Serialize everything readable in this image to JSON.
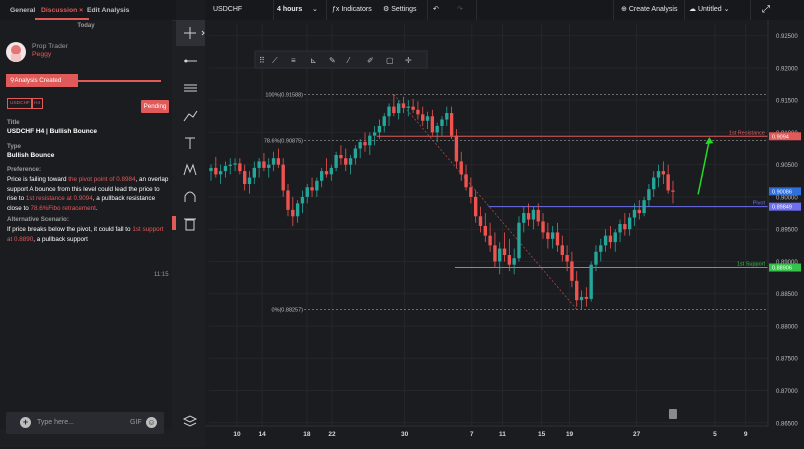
{
  "panel": {
    "tabs": [
      {
        "label": "General"
      },
      {
        "label": "Discussion ×"
      },
      {
        "label": "Edit Analysis"
      }
    ],
    "today": "Today",
    "author_role": "Prop Trader",
    "author_name": "Peggy",
    "status_banner": "Analysis Created",
    "tag1": "USDCHF",
    "tag2": "H4",
    "pending": "Pending",
    "title_label": "Title",
    "title_value": "USDCHF H4 | Bullish Bounce",
    "type_label": "Type",
    "type_value": "Bullish Bounce",
    "pref_label": "Preference:",
    "pref_parts": [
      "Price is failing toward ",
      "the pivot point of 0.8984",
      ", an overlap support  A bounce from this level could lead the price to rise to ",
      "1st resistance at 0.9094",
      ", a pullback resistance close to ",
      "78.6%Fibo retracement",
      "."
    ],
    "alt_label": "Alternative Scenario:",
    "alt_parts": [
      "If price breaks below the pivot, it could fall to ",
      "1st support at 0.8890",
      ", a pullback support"
    ],
    "time": "11:15",
    "input_placeholder": "Type here...",
    "gif_label": "GIF"
  },
  "toolbar": {
    "symbol": "USDCHF",
    "interval": "4 hours",
    "indicators": "Indicators",
    "settings": "Settings",
    "create_analysis": "Create Analysis",
    "layout_name": "Untitled"
  },
  "chart_data": {
    "type": "candlestick",
    "symbol": "USDCHF",
    "interval": "4 hours",
    "y_ticks": [
      "0.92500",
      "0.92000",
      "0.91500",
      "0.91000",
      "0.90500",
      "0.90000",
      "0.89500",
      "0.89000",
      "0.88500",
      "0.88000",
      "0.87500",
      "0.87000",
      "0.86500"
    ],
    "x_ticks": [
      "10",
      "14",
      "18",
      "22",
      "30",
      "7",
      "11",
      "15",
      "19",
      "27",
      "5",
      "9",
      "13"
    ],
    "x_tick_pos": [
      0.05,
      0.095,
      0.175,
      0.22,
      0.35,
      0.47,
      0.525,
      0.595,
      0.645,
      0.765,
      0.905,
      0.96,
      1.02
    ],
    "ylim": [
      0.8645,
      0.9268
    ],
    "lines": [
      {
        "name": "1st Resistance",
        "value": 0.9094,
        "label_value": "0.9094",
        "color": "#e05a5a"
      },
      {
        "name": "Pivot",
        "value": 0.89849,
        "label_value": "0.89849",
        "color": "#6e6ef0"
      },
      {
        "name": "1st Support",
        "value": 0.88906,
        "label_value": "0.88906",
        "color": "#36c24a"
      }
    ],
    "current_price": {
      "value": 0.90086,
      "label": "0.90086",
      "color": "#2f6fdc"
    },
    "fib_levels": [
      {
        "label": "100%(0.91588)",
        "value": 0.91588
      },
      {
        "label": "78.6%(0.90875)",
        "value": 0.90875
      },
      {
        "label": "0%(0.88257)",
        "value": 0.88257
      }
    ],
    "candles": [
      [
        0.904,
        0.905,
        0.9025,
        0.9045
      ],
      [
        0.9045,
        0.9062,
        0.903,
        0.9035
      ],
      [
        0.9035,
        0.905,
        0.902,
        0.904
      ],
      [
        0.904,
        0.9055,
        0.903,
        0.9048
      ],
      [
        0.9048,
        0.906,
        0.9035,
        0.905
      ],
      [
        0.905,
        0.906,
        0.904,
        0.9052
      ],
      [
        0.9052,
        0.906,
        0.9035,
        0.904
      ],
      [
        0.904,
        0.905,
        0.901,
        0.902
      ],
      [
        0.902,
        0.904,
        0.9005,
        0.903
      ],
      [
        0.903,
        0.9055,
        0.902,
        0.9045
      ],
      [
        0.9045,
        0.906,
        0.903,
        0.9055
      ],
      [
        0.9055,
        0.9068,
        0.904,
        0.9045
      ],
      [
        0.9045,
        0.906,
        0.903,
        0.905
      ],
      [
        0.905,
        0.907,
        0.904,
        0.906
      ],
      [
        0.906,
        0.9075,
        0.9045,
        0.905
      ],
      [
        0.905,
        0.906,
        0.9,
        0.901
      ],
      [
        0.901,
        0.902,
        0.897,
        0.898
      ],
      [
        0.898,
        0.9,
        0.8955,
        0.897
      ],
      [
        0.897,
        0.8995,
        0.896,
        0.899
      ],
      [
        0.899,
        0.901,
        0.8975,
        0.9
      ],
      [
        0.9,
        0.902,
        0.899,
        0.9015
      ],
      [
        0.9015,
        0.903,
        0.9,
        0.901
      ],
      [
        0.901,
        0.903,
        0.9,
        0.9025
      ],
      [
        0.9025,
        0.9045,
        0.9015,
        0.904
      ],
      [
        0.904,
        0.906,
        0.903,
        0.9035
      ],
      [
        0.9035,
        0.905,
        0.9025,
        0.9045
      ],
      [
        0.9045,
        0.907,
        0.904,
        0.9065
      ],
      [
        0.9065,
        0.908,
        0.905,
        0.906
      ],
      [
        0.906,
        0.9075,
        0.904,
        0.905
      ],
      [
        0.905,
        0.9065,
        0.9035,
        0.906
      ],
      [
        0.906,
        0.908,
        0.905,
        0.9075
      ],
      [
        0.9075,
        0.909,
        0.906,
        0.9085
      ],
      [
        0.9085,
        0.91,
        0.907,
        0.908
      ],
      [
        0.908,
        0.91,
        0.9065,
        0.9095
      ],
      [
        0.9095,
        0.911,
        0.908,
        0.91
      ],
      [
        0.91,
        0.912,
        0.909,
        0.911
      ],
      [
        0.911,
        0.913,
        0.91,
        0.9125
      ],
      [
        0.9125,
        0.9145,
        0.911,
        0.914
      ],
      [
        0.914,
        0.9159,
        0.9125,
        0.913
      ],
      [
        0.913,
        0.915,
        0.912,
        0.9145
      ],
      [
        0.9145,
        0.9155,
        0.913,
        0.9138
      ],
      [
        0.9138,
        0.915,
        0.9125,
        0.914
      ],
      [
        0.914,
        0.9152,
        0.913,
        0.9135
      ],
      [
        0.9135,
        0.9148,
        0.912,
        0.9128
      ],
      [
        0.9128,
        0.914,
        0.911,
        0.9118
      ],
      [
        0.9118,
        0.9132,
        0.9105,
        0.9125
      ],
      [
        0.9125,
        0.9135,
        0.9095,
        0.91
      ],
      [
        0.91,
        0.9115,
        0.9085,
        0.911
      ],
      [
        0.911,
        0.9125,
        0.9095,
        0.912
      ],
      [
        0.912,
        0.914,
        0.911,
        0.913
      ],
      [
        0.913,
        0.914,
        0.909,
        0.9095
      ],
      [
        0.9095,
        0.9105,
        0.9045,
        0.9055
      ],
      [
        0.9055,
        0.907,
        0.9025,
        0.9035
      ],
      [
        0.9035,
        0.905,
        0.901,
        0.9015
      ],
      [
        0.9015,
        0.903,
        0.899,
        0.9
      ],
      [
        0.9,
        0.901,
        0.896,
        0.897
      ],
      [
        0.897,
        0.8985,
        0.8945,
        0.8955
      ],
      [
        0.8955,
        0.8975,
        0.893,
        0.894
      ],
      [
        0.894,
        0.896,
        0.8915,
        0.8925
      ],
      [
        0.8925,
        0.8945,
        0.889,
        0.89
      ],
      [
        0.89,
        0.893,
        0.888,
        0.892
      ],
      [
        0.892,
        0.8945,
        0.89,
        0.891
      ],
      [
        0.891,
        0.8935,
        0.8885,
        0.8895
      ],
      [
        0.8895,
        0.892,
        0.888,
        0.8905
      ],
      [
        0.8905,
        0.897,
        0.89,
        0.896
      ],
      [
        0.896,
        0.8985,
        0.8945,
        0.8975
      ],
      [
        0.8975,
        0.899,
        0.8955,
        0.8965
      ],
      [
        0.8965,
        0.8985,
        0.895,
        0.898
      ],
      [
        0.898,
        0.899,
        0.8955,
        0.8962
      ],
      [
        0.8962,
        0.8975,
        0.8935,
        0.8945
      ],
      [
        0.8945,
        0.896,
        0.892,
        0.8935
      ],
      [
        0.8935,
        0.8955,
        0.892,
        0.8945
      ],
      [
        0.8945,
        0.896,
        0.8915,
        0.8925
      ],
      [
        0.8925,
        0.894,
        0.89,
        0.891
      ],
      [
        0.891,
        0.8925,
        0.8885,
        0.89
      ],
      [
        0.89,
        0.8915,
        0.886,
        0.887
      ],
      [
        0.887,
        0.8885,
        0.883,
        0.884
      ],
      [
        0.884,
        0.8855,
        0.8826,
        0.8845
      ],
      [
        0.8845,
        0.886,
        0.883,
        0.8842
      ],
      [
        0.8842,
        0.89,
        0.8838,
        0.8895
      ],
      [
        0.8895,
        0.8925,
        0.8885,
        0.8915
      ],
      [
        0.8915,
        0.8935,
        0.89,
        0.8925
      ],
      [
        0.8925,
        0.895,
        0.8915,
        0.894
      ],
      [
        0.894,
        0.8955,
        0.892,
        0.893
      ],
      [
        0.893,
        0.895,
        0.8915,
        0.8945
      ],
      [
        0.8945,
        0.8965,
        0.893,
        0.8958
      ],
      [
        0.8958,
        0.8975,
        0.894,
        0.895
      ],
      [
        0.895,
        0.8975,
        0.894,
        0.8968
      ],
      [
        0.8968,
        0.899,
        0.8955,
        0.898
      ],
      [
        0.898,
        0.8995,
        0.8965,
        0.8975
      ],
      [
        0.8975,
        0.9,
        0.897,
        0.8995
      ],
      [
        0.8995,
        0.902,
        0.8985,
        0.9012
      ],
      [
        0.9012,
        0.904,
        0.9,
        0.903
      ],
      [
        0.903,
        0.905,
        0.9015,
        0.904
      ],
      [
        0.904,
        0.9055,
        0.902,
        0.9035
      ],
      [
        0.9035,
        0.905,
        0.9005,
        0.901
      ],
      [
        0.901,
        0.9025,
        0.899,
        0.9008
      ]
    ]
  }
}
